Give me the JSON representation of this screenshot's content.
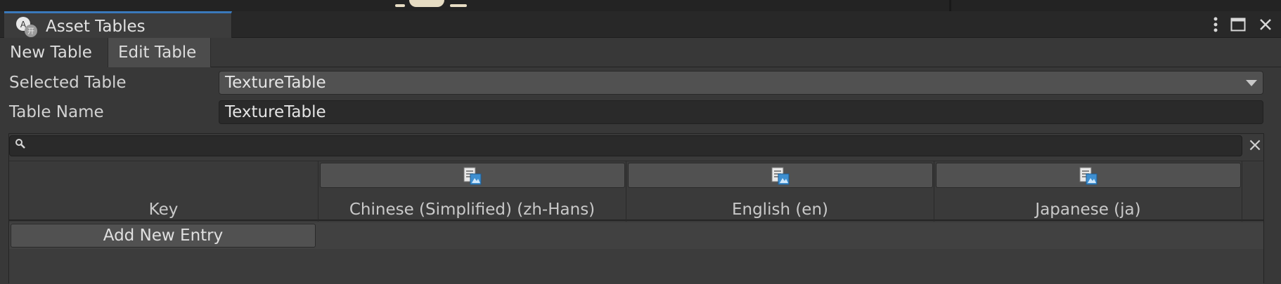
{
  "window": {
    "tab_title": "Asset Tables",
    "accent_color": "#3a79bb"
  },
  "modes": {
    "new_table": "New Table",
    "edit_table": "Edit Table",
    "active": "Edit Table"
  },
  "fields": {
    "selected_table_label": "Selected Table",
    "selected_table_value": "TextureTable",
    "table_name_label": "Table Name",
    "table_name_value": "TextureTable"
  },
  "search": {
    "value": ""
  },
  "table": {
    "key_header": "Key",
    "columns": [
      {
        "label": "Chinese (Simplified) (zh-Hans)",
        "icon": "asset-table-icon"
      },
      {
        "label": "English (en)",
        "icon": "asset-table-icon"
      },
      {
        "label": "Japanese (ja)",
        "icon": "asset-table-icon"
      }
    ],
    "add_entry_label": "Add New Entry"
  }
}
